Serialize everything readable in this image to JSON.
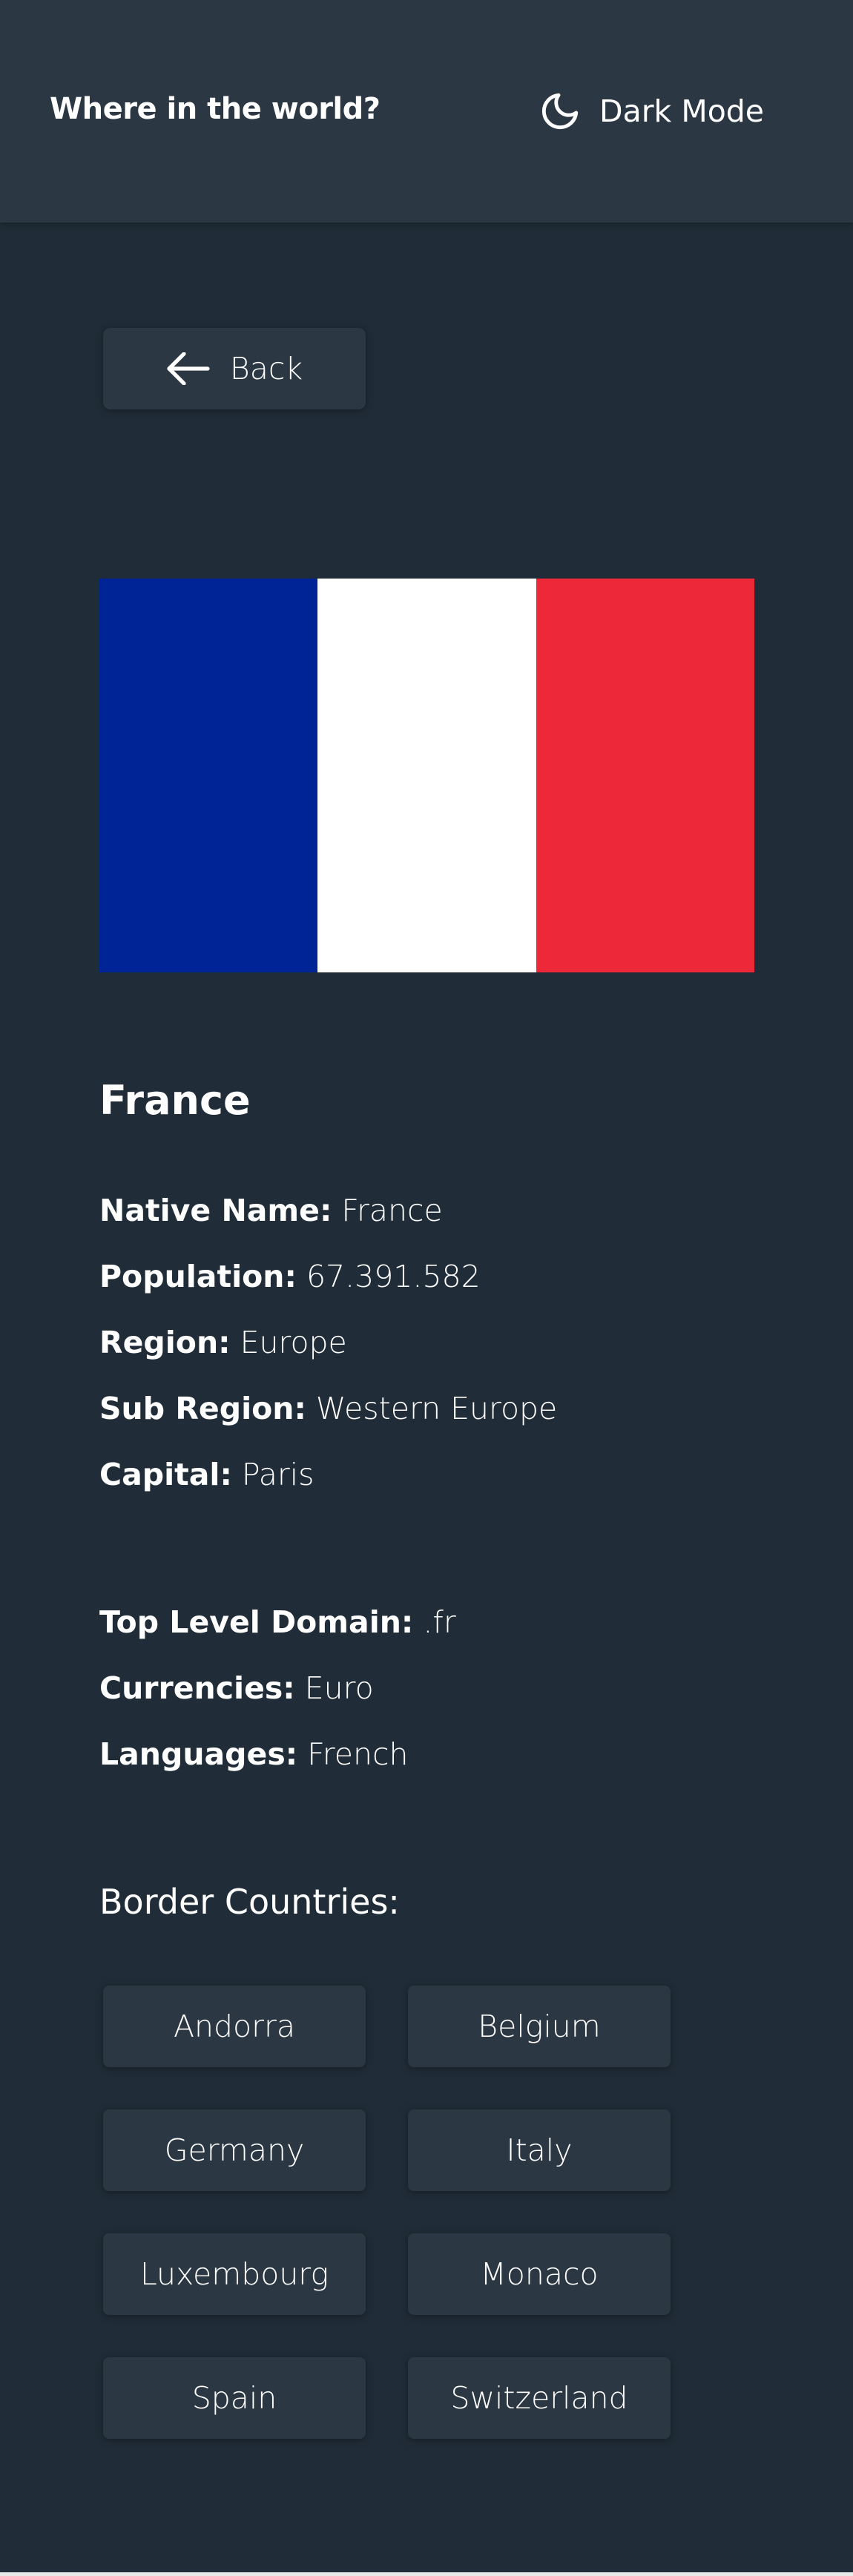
{
  "header": {
    "title": "Where in the world?",
    "theme_toggle_label": "Dark Mode",
    "theme_icon": "moon-icon"
  },
  "back_button": {
    "label": "Back",
    "icon": "arrow-left-icon"
  },
  "flag": {
    "stripes": [
      "#002395",
      "#ffffff",
      "#ed2939"
    ]
  },
  "country": {
    "name": "France",
    "details_primary": [
      {
        "label": "Native Name:",
        "value": "France"
      },
      {
        "label": "Population:",
        "value": "67.391.582"
      },
      {
        "label": "Region:",
        "value": "Europe"
      },
      {
        "label": "Sub Region:",
        "value": "Western Europe"
      },
      {
        "label": "Capital:",
        "value": "Paris"
      }
    ],
    "details_secondary": [
      {
        "label": "Top Level Domain:",
        "value": ".fr"
      },
      {
        "label": "Currencies:",
        "value": "Euro"
      },
      {
        "label": "Languages:",
        "value": "French"
      }
    ]
  },
  "border_countries": {
    "title": "Border Countries:",
    "items": [
      "Andorra",
      "Belgium",
      "Germany",
      "Italy",
      "Luxembourg",
      "Monaco",
      "Spain",
      "Switzerland"
    ]
  },
  "colors": {
    "background": "#202c37",
    "element": "#2b3743",
    "text": "#ffffff"
  }
}
